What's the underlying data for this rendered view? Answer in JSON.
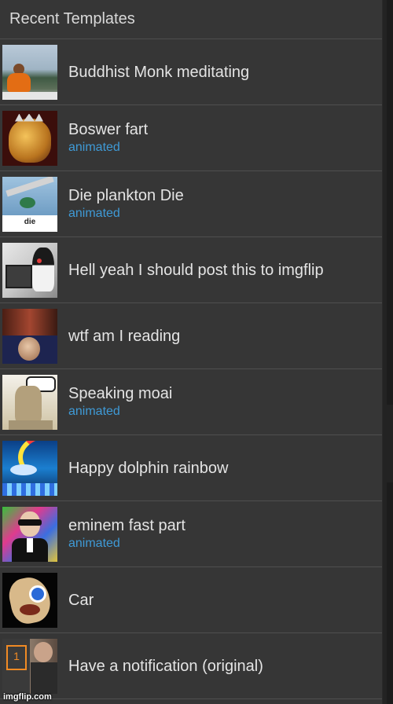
{
  "header": {
    "title": "Recent Templates"
  },
  "templates": [
    {
      "title": "Buddhist Monk meditating",
      "subtitle": ""
    },
    {
      "title": "Boswer fart",
      "subtitle": "animated"
    },
    {
      "title": "Die plankton Die",
      "subtitle": "animated",
      "thumb_caption": "die"
    },
    {
      "title": "Hell yeah I should post this to imgflip",
      "subtitle": ""
    },
    {
      "title": "wtf am I reading",
      "subtitle": ""
    },
    {
      "title": "Speaking moai",
      "subtitle": "animated"
    },
    {
      "title": "Happy dolphin rainbow",
      "subtitle": ""
    },
    {
      "title": "eminem fast part",
      "subtitle": "animated"
    },
    {
      "title": "Car",
      "subtitle": ""
    },
    {
      "title": "Have a notification (original)",
      "subtitle": "",
      "thumb_badge": "1"
    }
  ],
  "watermark": "imgflip.com",
  "colors": {
    "panel": "#363636",
    "background": "#232323",
    "accent": "#3f9ad6",
    "text": "#e4e4e4"
  }
}
